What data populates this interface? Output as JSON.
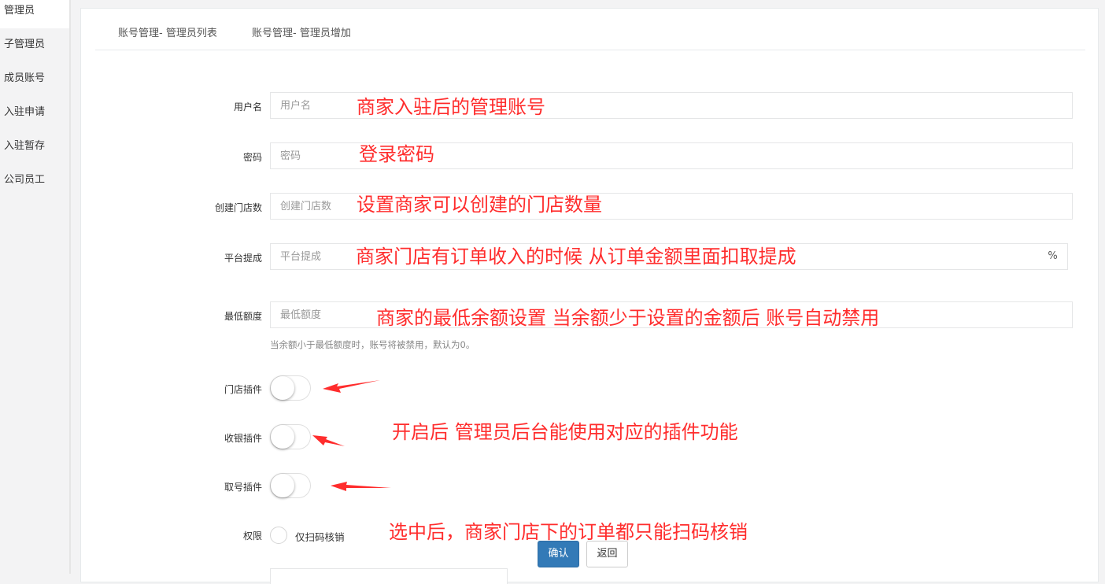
{
  "sidebar": {
    "items": [
      {
        "label": "管理员"
      },
      {
        "label": "子管理员"
      },
      {
        "label": "成员账号"
      },
      {
        "label": "入驻申请"
      },
      {
        "label": "入驻暂存"
      },
      {
        "label": "公司员工"
      }
    ]
  },
  "tabs": [
    {
      "label": "账号管理- 管理员列表"
    },
    {
      "label": "账号管理- 管理员增加"
    }
  ],
  "form": {
    "username": {
      "label": "用户名",
      "placeholder": "用户名"
    },
    "password": {
      "label": "密码",
      "placeholder": "密码"
    },
    "store_count": {
      "label": "创建门店数",
      "placeholder": "创建门店数"
    },
    "commission": {
      "label": "平台提成",
      "placeholder": "平台提成",
      "addon": "%"
    },
    "min_balance": {
      "label": "最低额度",
      "placeholder": "最低额度",
      "help": "当余额小于最低额度时，账号将被禁用，默认为0。"
    },
    "store_plugin": {
      "label": "门店插件",
      "enabled": false
    },
    "cashier_plugin": {
      "label": "收银插件",
      "enabled": false
    },
    "queue_plugin": {
      "label": "取号插件",
      "enabled": false
    },
    "permission": {
      "label": "权限",
      "option": "仅扫码核销",
      "checked": false
    },
    "confirm_label": "确认",
    "back_label": "返回"
  },
  "annotations": {
    "username": "商家入驻后的管理账号",
    "password": "登录密码",
    "store_count": "设置商家可以创建的门店数量",
    "commission": "商家门店有订单收入的时候 从订单金额里面扣取提成",
    "min_balance": "商家的最低余额设置 当余额少于设置的金额后 账号自动禁用",
    "plugins": "开启后 管理员后台能使用对应的插件功能",
    "permission": "选中后，商家门店下的订单都只能扫码核销"
  },
  "colors": {
    "annotation": "#ff2d2d",
    "primary_button": "#337ab7"
  }
}
